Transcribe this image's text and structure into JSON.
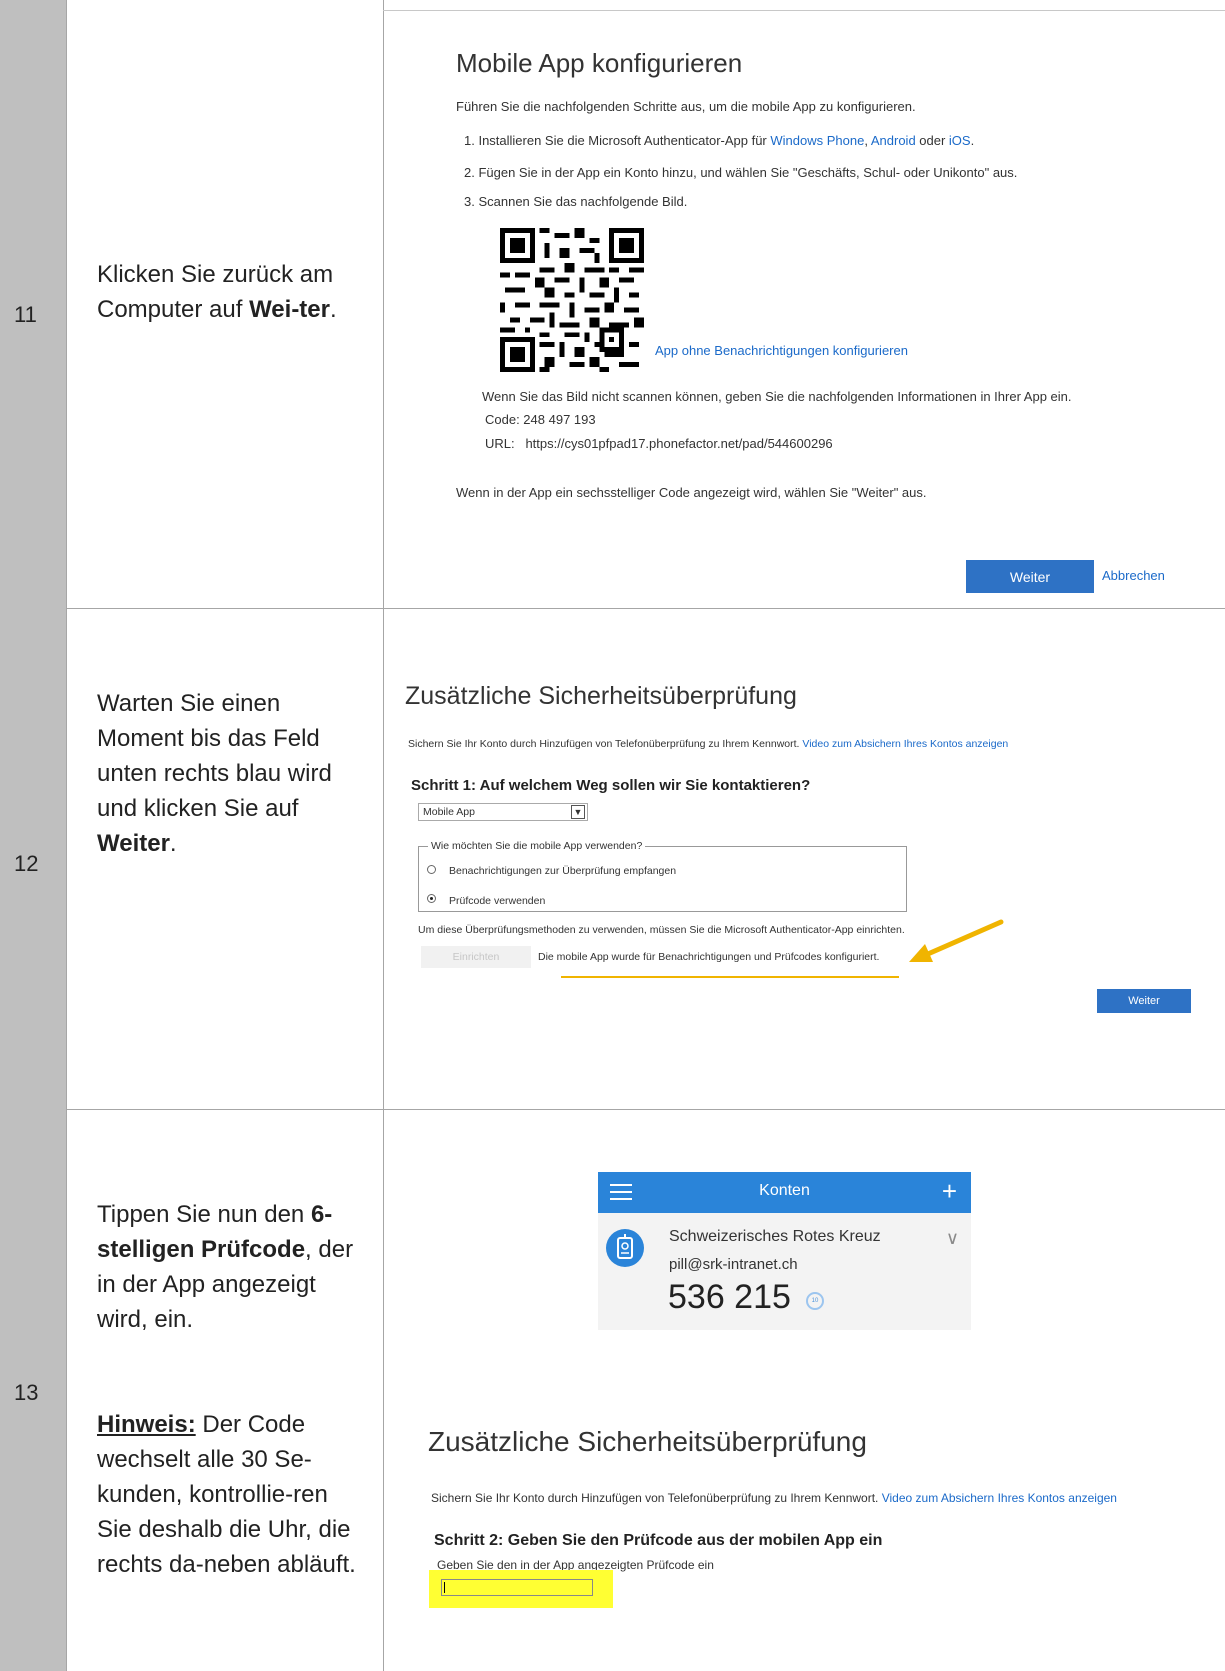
{
  "rows": [
    {
      "number": "11",
      "instruction_parts": [
        "Klicken Sie zurück am Computer auf ",
        "Wei-ter",
        "."
      ],
      "screenshot": {
        "title": "Mobile App konfigurieren",
        "intro": "Führen Sie die nachfolgenden Schritte aus, um die mobile App zu konfigurieren.",
        "step1_prefix": "1. Installieren Sie die Microsoft Authenticator-App für ",
        "step1_link1": "Windows Phone",
        "step1_sep": ", ",
        "step1_link2": "Android",
        "step1_or": " oder ",
        "step1_link3": "iOS",
        "step1_end": ".",
        "step2": "2. Fügen Sie in der App ein Konto hinzu, und wählen Sie \"Geschäfts, Schul- oder Unikonto\" aus.",
        "step3": "3. Scannen Sie das nachfolgende Bild.",
        "app_link": "App ohne Benachrichtigungen konfigurieren",
        "no_scan_text": "Wenn Sie das Bild nicht scannen können, geben Sie die nachfolgenden Informationen in Ihrer App ein.",
        "code_line": "Code: 248 497 193",
        "url_line": "URL:   https://cys01pfpad17.phonefactor.net/pad/544600296",
        "six_digit_text": "Wenn in der App ein sechsstelliger Code angezeigt wird, wählen Sie \"Weiter\" aus.",
        "next_button": "Weiter",
        "cancel_link": "Abbrechen"
      }
    },
    {
      "number": "12",
      "instruction_parts": [
        "Warten Sie einen Moment bis das Feld unten rechts blau wird und  klicken Sie auf ",
        "Weiter",
        "."
      ],
      "screenshot": {
        "title": "Zusätzliche Sicherheitsüberprüfung",
        "intro": "Sichern Sie Ihr Konto durch Hinzufügen von Telefonüberprüfung zu Ihrem Kennwort. ",
        "video_link": "Video zum Absichern Ihres Kontos anzeigen",
        "step_heading": "Schritt 1: Auf welchem Weg sollen wir Sie kontaktieren?",
        "select_value": "Mobile App",
        "fieldset_legend": "Wie möchten Sie die mobile App verwenden?",
        "option1": "Benachrichtigungen zur Überprüfung empfangen",
        "option2": "Prüfcode verwenden",
        "requirement_text": "Um diese Überprüfungsmethoden zu verwenden, müssen Sie die Microsoft Authenticator-App einrichten.",
        "setup_button": "Einrichten",
        "configured_text": "Die mobile App wurde für Benachrichtigungen und Prüfcodes konfiguriert.",
        "next_button": "Weiter"
      }
    },
    {
      "number": "13",
      "instruction_parts": [
        "Tippen Sie nun den ",
        "6-stelligen Prüfcode",
        ", der in der App angezeigt wird, ein."
      ],
      "note_label": "Hinweis:",
      "note_text": " Der Code wechselt alle 30 Se-kunden, kontrollie-ren Sie deshalb die Uhr, die rechts da-neben abläuft.",
      "phone": {
        "bar_title": "Konten",
        "org": "Schweizerisches Rotes Kreuz",
        "email": "pill@srk-intranet.ch",
        "code": "536 215",
        "timer": "10"
      },
      "screenshot": {
        "title": "Zusätzliche Sicherheitsüberprüfung",
        "intro": "Sichern Sie Ihr Konto durch Hinzufügen von Telefonüberprüfung zu Ihrem Kennwort. ",
        "video_link": "Video zum Absichern Ihres Kontos anzeigen",
        "step_heading": "Schritt 2: Geben Sie den Prüfcode aus der mobilen App ein",
        "input_label": "Geben Sie den in der App angezeigten Prüfcode ein"
      }
    }
  ]
}
